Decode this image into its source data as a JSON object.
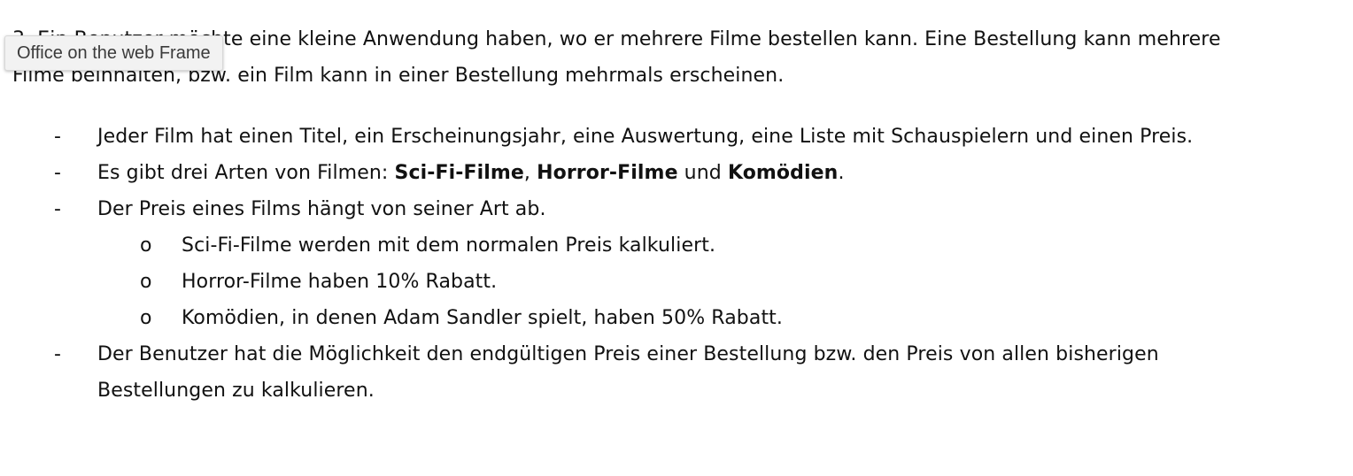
{
  "tooltip": {
    "text": "Office on the web Frame"
  },
  "intro": {
    "line1": "3. Ein Benutzer möchte eine kleine Anwendung haben, wo er mehrere Filme bestellen kann. Eine Bestellung kann mehrere",
    "line2": "Filme beinhalten, bzw. ein Film kann in einer Bestellung mehrmals erscheinen."
  },
  "list": {
    "marker": "-",
    "sub_marker": "o",
    "item1": "Jeder Film hat einen Titel, ein Erscheinungsjahr, eine Auswertung, eine Liste mit Schauspielern und einen Preis.",
    "item2": {
      "prefix": "Es gibt drei Arten von Filmen: ",
      "type1": "Sci-Fi-Filme",
      "sep1": ", ",
      "type2": "Horror-Filme",
      "sep2": " und ",
      "type3": "Komödien",
      "suffix": "."
    },
    "item3": "Der Preis eines Films hängt von seiner Art ab.",
    "sub_items": [
      "Sci-Fi-Filme werden mit dem normalen Preis kalkuliert.",
      "Horror-Filme haben 10% Rabatt.",
      "Komödien, in denen Adam Sandler spielt, haben 50% Rabatt."
    ],
    "item4": {
      "line1": "Der Benutzer hat die Möglichkeit den endgültigen Preis einer Bestellung bzw. den Preis von allen bisherigen",
      "line2": "Bestellungen zu kalkulieren."
    }
  }
}
